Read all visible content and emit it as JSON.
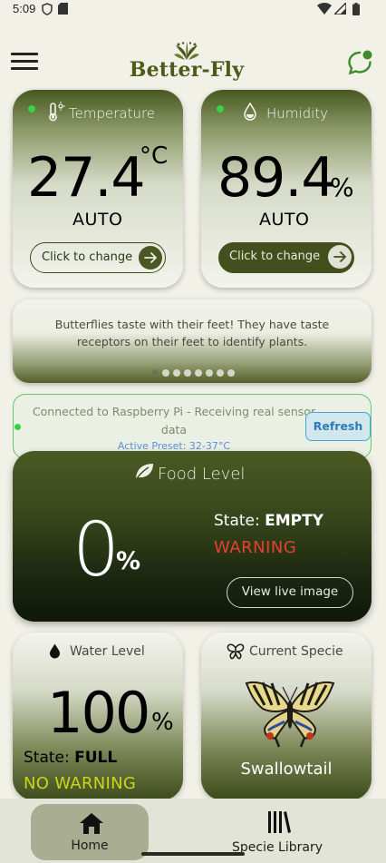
{
  "status_bar": {
    "time": "5:09"
  },
  "header": {
    "app_name": "Better-Fly"
  },
  "temperature": {
    "title": "Temperature",
    "value": "27.4",
    "unit": "°C",
    "mode": "AUTO",
    "change_label": "Click to change"
  },
  "humidity": {
    "title": "Humidity",
    "value": "89.4",
    "unit": "%",
    "mode": "AUTO",
    "change_label": "Click to change"
  },
  "fact": {
    "text": "Butterflies taste with their feet! They have taste receptors on their feet to identify plants.",
    "page_count": 8,
    "active_index": 0
  },
  "connection": {
    "message": "Connected to Raspberry Pi - Receiving real sensor data",
    "preset": "Active Preset: 32-37°C",
    "refresh_label": "Refresh"
  },
  "food": {
    "title": "Food Level",
    "value": "0",
    "unit": "%",
    "state_label": "State: ",
    "state_value": "EMPTY",
    "alert": "WARNING",
    "view_label": "View live image"
  },
  "water": {
    "title": "Water Level",
    "value": "100",
    "unit": "%",
    "state_label": "State: ",
    "state_value": "FULL",
    "alert": "NO WARNING"
  },
  "specie": {
    "title": "Current Specie",
    "name": "Swallowtail"
  },
  "nav": {
    "home_label": "Home",
    "library_label": "Specie Library"
  },
  "colors": {
    "background": "#f1f1e8",
    "brand_olive": "#4d5a1c",
    "live_dot": "#3bd046",
    "warning": "#e6412e",
    "ok": "#c7d81a",
    "refresh_blue": "#2a7bb8"
  }
}
